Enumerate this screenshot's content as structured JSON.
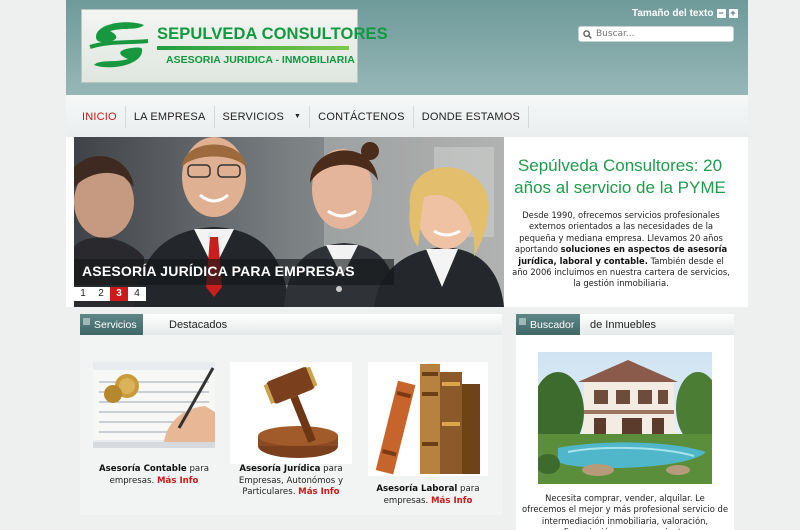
{
  "header": {
    "logo_title": "SEPULVEDA CONSULTORES",
    "logo_subtitle": "ASESORIA JURIDICA - INMOBILIARIA",
    "text_size_label": "Tamaño del texto",
    "text_size_decrease": "−",
    "text_size_increase": "+",
    "search_placeholder": "Buscar..."
  },
  "nav": {
    "items": [
      "INICIO",
      "LA EMPRESA",
      "SERVICIOS",
      "CONTÁCTENOS",
      "DONDE ESTAMOS"
    ],
    "active": "INICIO"
  },
  "hero": {
    "caption": "ASESORÍA JURÍDICA PARA EMPRESAS",
    "pages": [
      "1",
      "2",
      "3",
      "4"
    ],
    "current_page": "3"
  },
  "intro": {
    "title": "Sepúlveda Consultores: 20 años al servicio de la PYME",
    "text_part1": "Desde 1990, ofrecemos servicios profesionales externos orientados a las necesidades de la pequeña y mediana empresa. Llevamos 20 años aportando ",
    "text_bold": "soluciones en aspectos de asesoría jurídica, laboral y contable.",
    "text_part2": " También desde el año 2006 incluimos en nuestra cartera de servicios, la gestión inmobiliaria."
  },
  "services": {
    "tab_label": "Servicios",
    "heading_rest": "Destacados",
    "items": [
      {
        "title": "Asesoría Contable",
        "desc": " para empresas. ",
        "more": "Más Info",
        "icon": "accounting-image"
      },
      {
        "title": "Asesoría Jurídica",
        "desc": " para Empresas, Autonómos y Particulares. ",
        "more": "Más Info",
        "icon": "gavel-image"
      },
      {
        "title": "Asesoría Laboral",
        "desc": " para empresas. ",
        "more": "Más Info",
        "icon": "books-image"
      }
    ]
  },
  "inmuebles": {
    "tab_label": "Buscador",
    "heading_rest": "de Inmuebles",
    "text": "Necesita comprar, vender, alquilar. Le ofrecemos el mejor y más profesional servicio de intermediación inmobiliaria, valoración, financiación y asesoramiento"
  },
  "colors": {
    "brand_green": "#109a3f",
    "accent_red": "#cc1a1a",
    "header_teal": "#7ea4a4"
  }
}
